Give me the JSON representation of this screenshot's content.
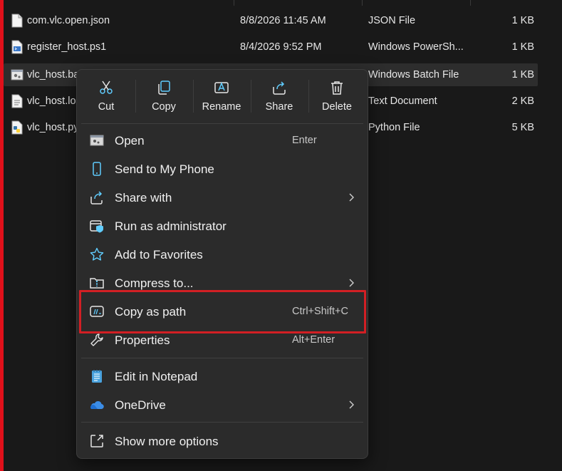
{
  "files": [
    {
      "name": "com.vlc.open.json",
      "date": "8/8/2026 11:45 AM",
      "type": "JSON File",
      "size": "1 KB",
      "icon": "document-icon"
    },
    {
      "name": "register_host.ps1",
      "date": "8/4/2026 9:52 PM",
      "type": "Windows PowerSh...",
      "size": "1 KB",
      "icon": "powershell-script-icon"
    },
    {
      "name": "vlc_host.ba",
      "date": "",
      "type": "Windows Batch File",
      "size": "1 KB",
      "icon": "batch-file-icon",
      "selected": true
    },
    {
      "name": "vlc_host.lo",
      "date": "",
      "type": "Text Document",
      "size": "2 KB",
      "icon": "text-file-icon"
    },
    {
      "name": "vlc_host.py",
      "date": "",
      "type": "Python File",
      "size": "5 KB",
      "icon": "python-file-icon"
    }
  ],
  "context_menu": {
    "quick_actions": [
      {
        "label": "Cut",
        "icon": "scissors-icon"
      },
      {
        "label": "Copy",
        "icon": "copy-icon"
      },
      {
        "label": "Rename",
        "icon": "rename-icon"
      },
      {
        "label": "Share",
        "icon": "share-icon"
      },
      {
        "label": "Delete",
        "icon": "trash-icon"
      }
    ],
    "items": [
      {
        "label": "Open",
        "shortcut": "Enter",
        "icon": "open-window-icon"
      },
      {
        "label": "Send to My Phone",
        "shortcut": "",
        "icon": "phone-icon"
      },
      {
        "label": "Share with",
        "shortcut": "",
        "icon": "share-with-icon",
        "submenu": true
      },
      {
        "label": "Run as administrator",
        "shortcut": "",
        "icon": "admin-shield-icon"
      },
      {
        "label": "Add to Favorites",
        "shortcut": "",
        "icon": "star-icon"
      },
      {
        "label": "Compress to...",
        "shortcut": "",
        "icon": "compress-folder-icon",
        "submenu": true
      },
      {
        "label": "Copy as path",
        "shortcut": "Ctrl+Shift+C",
        "icon": "copy-path-icon",
        "highlighted": true
      },
      {
        "label": "Properties",
        "shortcut": "Alt+Enter",
        "icon": "wrench-icon"
      },
      {
        "label": "Edit in Notepad",
        "shortcut": "",
        "icon": "notepad-icon"
      },
      {
        "label": "OneDrive",
        "shortcut": "",
        "icon": "onedrive-cloud-icon",
        "submenu": true
      },
      {
        "label": "Show more options",
        "shortcut": "",
        "icon": "more-options-icon"
      }
    ]
  },
  "colors": {
    "accent": "#60cdff",
    "highlight_border": "#d21f24",
    "left_bar": "#e0101a"
  }
}
